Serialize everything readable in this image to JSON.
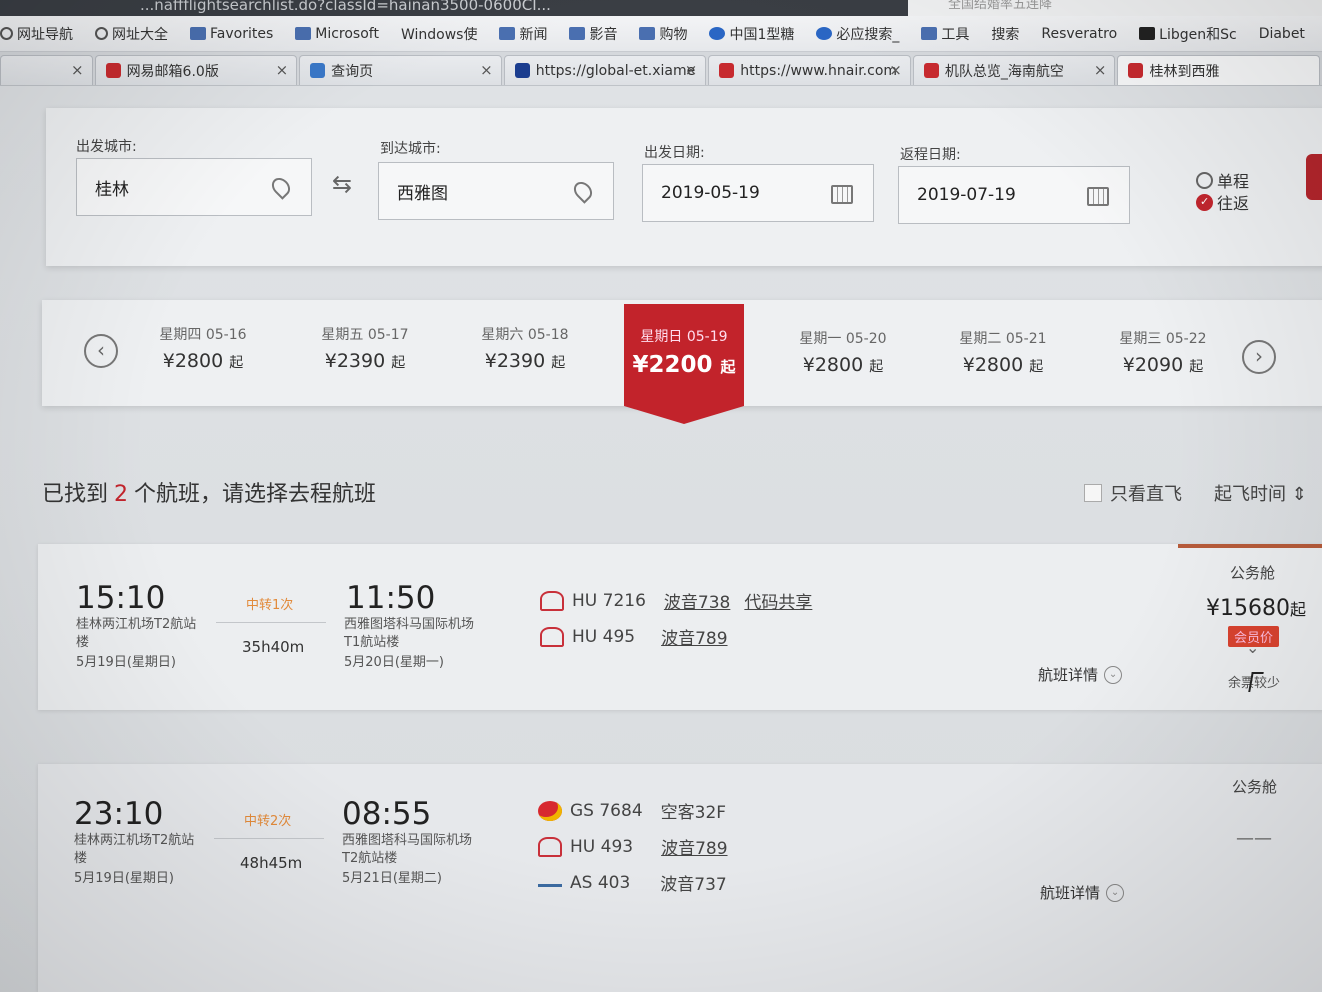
{
  "browser": {
    "url_partial": "...naffflightsearchlist.do?classId=hainan3500-0600CI...",
    "site_search_text": "全国结婚率五连降",
    "bookmarks": [
      {
        "label": "网址导航",
        "icon": "globe-icon"
      },
      {
        "label": "网址大全",
        "icon": "globe-icon"
      },
      {
        "label": "Favorites",
        "icon": "folder-icon"
      },
      {
        "label": "Microsoft",
        "icon": "folder-icon"
      },
      {
        "label": "Windows使",
        "icon": "page-icon"
      },
      {
        "label": "新闻",
        "icon": "folder-icon"
      },
      {
        "label": "影音",
        "icon": "folder-icon"
      },
      {
        "label": "购物",
        "icon": "folder-icon"
      },
      {
        "label": "中国1型糖",
        "icon": "blue-icon"
      },
      {
        "label": "必应搜索_",
        "icon": "blue-icon"
      },
      {
        "label": "工具",
        "icon": "folder-icon"
      },
      {
        "label": "搜索",
        "icon": "page-icon"
      },
      {
        "label": "Resveratro",
        "icon": "page-icon"
      },
      {
        "label": "Libgen和Sc",
        "icon": "dark-icon"
      },
      {
        "label": "Diabet",
        "icon": "page-icon"
      }
    ],
    "tabs": [
      {
        "label": "",
        "fav": ""
      },
      {
        "label": "网易邮箱6.0版",
        "fav": "red"
      },
      {
        "label": "查询页",
        "fav": "blue"
      },
      {
        "label": "https://global-et.xiame",
        "fav": "navy"
      },
      {
        "label": "https://www.hnair.com",
        "fav": "red"
      },
      {
        "label": "机队总览_海南航空",
        "fav": "red"
      },
      {
        "label": "桂林到西雅",
        "fav": "red"
      }
    ],
    "close_glyph": "×"
  },
  "search": {
    "depart_city_label": "出发城市:",
    "depart_city": "桂林",
    "arrive_city_label": "到达城市:",
    "arrive_city": "西雅图",
    "depart_date_label": "出发日期:",
    "depart_date": "2019-05-19",
    "return_date_label": "返程日期:",
    "return_date": "2019-07-19",
    "one_way": "单程",
    "round_trip": "往返",
    "swap_glyph": "⇆"
  },
  "date_bar": {
    "prev_glyph": "‹",
    "next_glyph": "›",
    "suffix": "起",
    "days": [
      {
        "day": "星期四 05-16",
        "price": "¥2800"
      },
      {
        "day": "星期五 05-17",
        "price": "¥2390"
      },
      {
        "day": "星期六 05-18",
        "price": "¥2390"
      },
      {
        "day": "星期日 05-19",
        "price": "¥2200"
      },
      {
        "day": "星期一 05-20",
        "price": "¥2800"
      },
      {
        "day": "星期二 05-21",
        "price": "¥2800"
      },
      {
        "day": "星期三 05-22",
        "price": "¥2090"
      }
    ]
  },
  "results": {
    "prefix": "已找到",
    "count": "2",
    "suffix": "个航班，请选择去程航班",
    "direct_only": "只看直飞",
    "sort_label": "起飞时间",
    "sort_glyph": "⇕"
  },
  "flights": [
    {
      "dep_time": "15:10",
      "dep_airport": "桂林两江机场T2航站楼",
      "dep_date": "5月19日(星期日)",
      "transfer": "中转1次",
      "duration": "35h40m",
      "arr_time": "11:50",
      "arr_airport": "西雅图塔科马国际机场T1航站楼",
      "arr_date": "5月20日(星期一)",
      "segments": [
        {
          "flight": "HU 7216",
          "plane": "波音738",
          "code_share": "代码共享"
        },
        {
          "flight": "HU 495",
          "plane": "波音789"
        }
      ],
      "detail": "航班详情",
      "cabin": "公务舱",
      "price": "¥15680",
      "price_suffix": "起",
      "member": "会员价",
      "few_tickets": "余票较少"
    },
    {
      "dep_time": "23:10",
      "dep_airport": "桂林两江机场T2航站楼",
      "dep_date": "5月19日(星期日)",
      "transfer": "中转2次",
      "duration": "48h45m",
      "arr_time": "08:55",
      "arr_airport": "西雅图塔科马国际机场T2航站楼",
      "arr_date": "5月21日(星期二)",
      "segments": [
        {
          "flight": "GS 7684",
          "plane": "空客32F"
        },
        {
          "flight": "HU 493",
          "plane": "波音789"
        },
        {
          "flight": "AS 403",
          "plane": "波音737"
        }
      ],
      "detail": "航班详情",
      "cabin": "公务舱",
      "price_placeholder": "——"
    }
  ],
  "colors": {
    "accent": "#c2232b",
    "transfer": "#e28a3a"
  }
}
